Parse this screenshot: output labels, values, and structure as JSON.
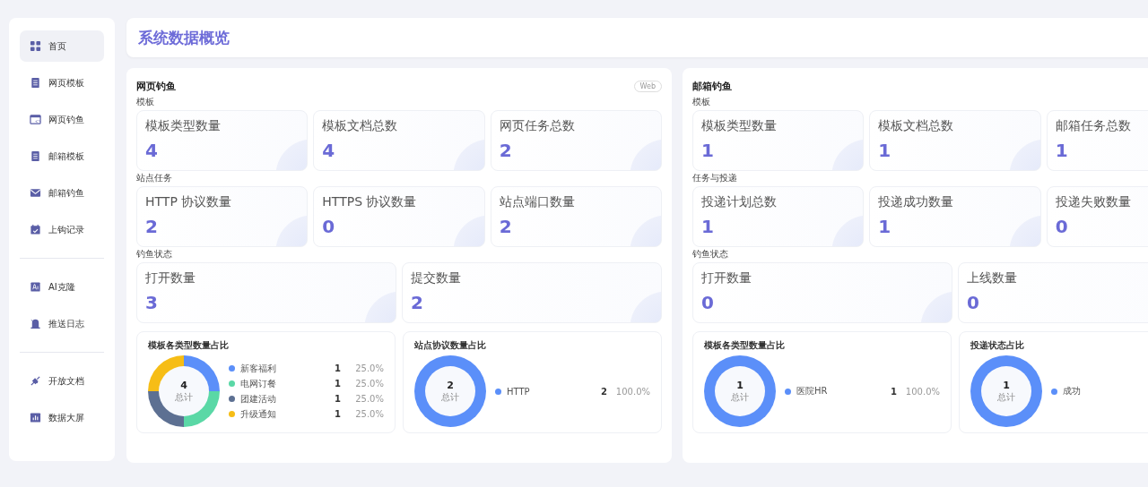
{
  "sidebar": {
    "groups": [
      [
        {
          "label": "首页",
          "selected": true
        },
        {
          "label": "网页模板",
          "selected": false
        },
        {
          "label": "网页钓鱼",
          "selected": false
        },
        {
          "label": "邮箱模板",
          "selected": false
        },
        {
          "label": "邮箱钓鱼",
          "selected": false
        },
        {
          "label": "上钩记录",
          "selected": false
        }
      ],
      [
        {
          "label": "AI克隆",
          "selected": false
        },
        {
          "label": "推送日志",
          "selected": false
        }
      ],
      [
        {
          "label": "开放文档",
          "selected": false
        },
        {
          "label": "数据大屏",
          "selected": false
        }
      ]
    ]
  },
  "header": {
    "title": "系统数据概览"
  },
  "panels": [
    {
      "title": "网页钓鱼",
      "badge": "Web",
      "sections": [
        {
          "label": "模板",
          "cards": [
            {
              "label": "模板类型数量",
              "value": "4"
            },
            {
              "label": "模板文档总数",
              "value": "4"
            },
            {
              "label": "网页任务总数",
              "value": "2"
            }
          ]
        },
        {
          "label": "站点任务",
          "cards": [
            {
              "label": "HTTP 协议数量",
              "value": "2"
            },
            {
              "label": "HTTPS 协议数量",
              "value": "0"
            },
            {
              "label": "站点端口数量",
              "value": "2"
            }
          ]
        },
        {
          "label": "钓鱼状态",
          "cards": [
            {
              "label": "打开数量",
              "value": "3"
            },
            {
              "label": "提交数量",
              "value": "2"
            }
          ]
        }
      ],
      "charts": [
        {
          "title": "模板各类型数量占比",
          "total": "4",
          "total_label": "总计",
          "legend": [
            {
              "color": "#5b8ff9",
              "count": "1",
              "percent": "25.0%"
            },
            {
              "color": "#5ad8a6",
              "count": "1",
              "percent": "25.0%"
            },
            {
              "color": "#5d7092",
              "count": "1",
              "percent": "25.0%"
            },
            {
              "color": "#f6bd16",
              "count": "1",
              "percent": "25.0%"
            }
          ],
          "chart_data": {
            "type": "donut",
            "categories": [
              "新客福利",
              "电网订餐",
              "团建活动",
              "升级通知"
            ],
            "values": [
              25,
              25,
              25,
              25
            ]
          }
        },
        {
          "title": "站点协议数量占比",
          "total": "2",
          "total_label": "总计",
          "legend": [
            {
              "color": "#5b8ff9",
              "count": "2",
              "percent": "100.0%"
            }
          ],
          "chart_data": {
            "type": "donut",
            "categories": [
              "HTTP"
            ],
            "values": [
              100
            ]
          }
        }
      ]
    },
    {
      "title": "邮箱钓鱼",
      "sections": [
        {
          "label": "模板",
          "cards": [
            {
              "label": "模板类型数量",
              "value": "1"
            },
            {
              "label": "模板文档总数",
              "value": "1"
            },
            {
              "label": "邮箱任务总数",
              "value": "1"
            }
          ]
        },
        {
          "label": "任务与投递",
          "cards": [
            {
              "label": "投递计划总数",
              "value": "1"
            },
            {
              "label": "投递成功数量",
              "value": "1"
            },
            {
              "label": "投递失败数量",
              "value": "0"
            }
          ]
        },
        {
          "label": "钓鱼状态",
          "cards": [
            {
              "label": "打开数量",
              "value": "0"
            },
            {
              "label": "上线数量",
              "value": "0"
            }
          ]
        }
      ],
      "charts": [
        {
          "title": "模板各类型数量占比",
          "total": "1",
          "total_label": "总计",
          "legend": [
            {
              "color": "#5b8ff9",
              "count": "1",
              "percent": "100.0%"
            }
          ],
          "chart_data": {
            "type": "donut",
            "categories": [
              "医院HR"
            ],
            "values": [
              100
            ]
          }
        },
        {
          "title": "投递状态占比",
          "total": "1",
          "total_label": "总计",
          "legend": [
            {
              "color": "#5b8ff9"
            }
          ],
          "chart_data": {
            "type": "donut",
            "categories": [
              "成功"
            ],
            "values": [
              100
            ]
          }
        }
      ]
    }
  ]
}
